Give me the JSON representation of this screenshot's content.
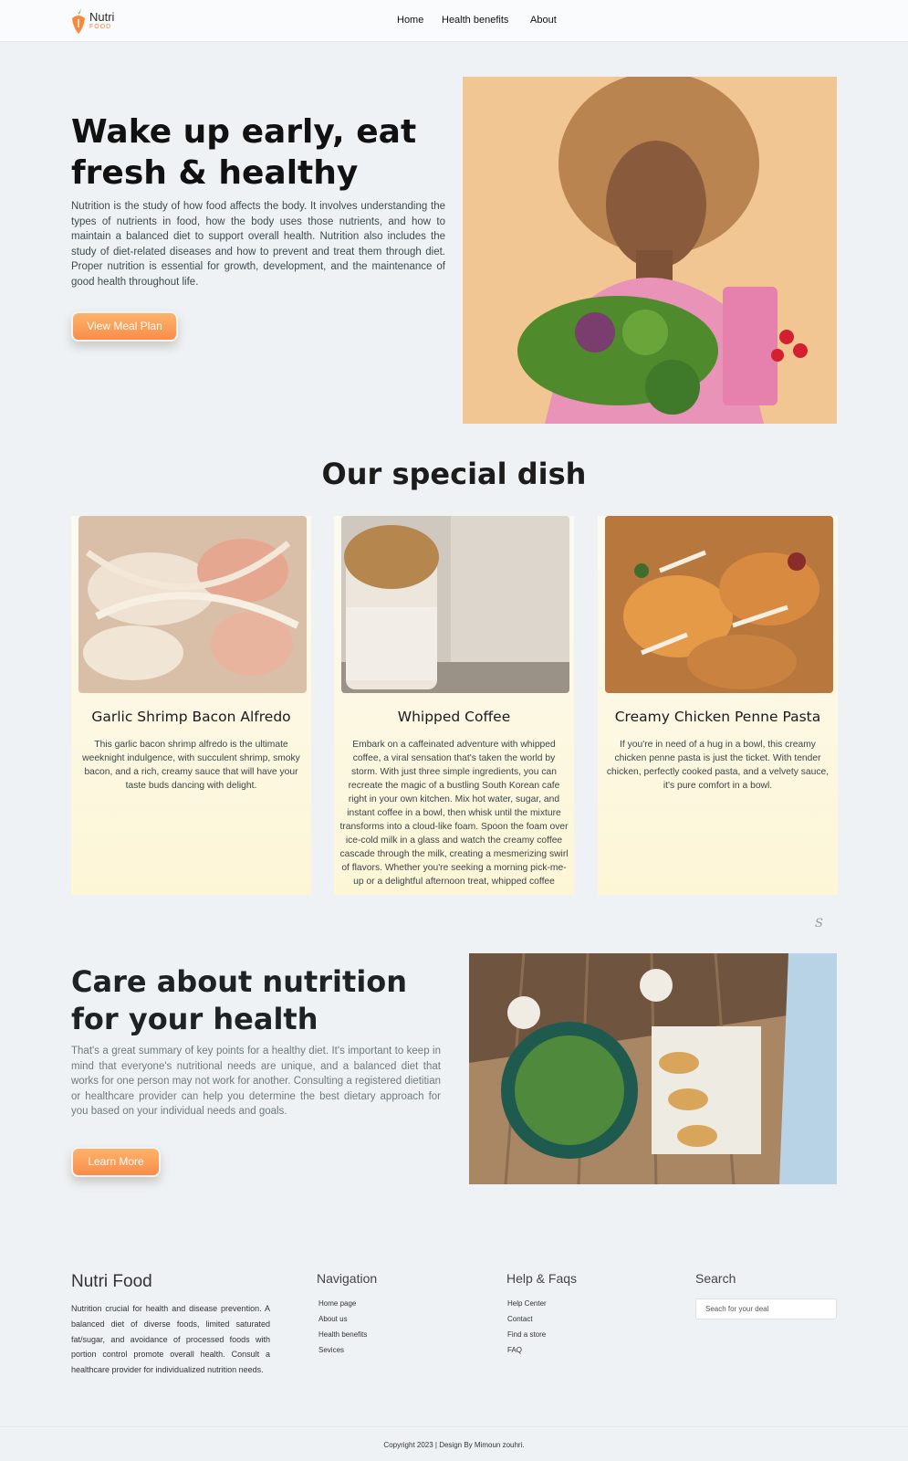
{
  "nav": {
    "logo_top": "Nutri",
    "logo_bottom": "FOOD",
    "links": [
      "Home",
      "Health benefits",
      "About"
    ]
  },
  "hero": {
    "title": "Wake up early, eat fresh & healthy",
    "text": "Nutrition is the study of how food affects the body. It involves understanding the types of nutrients in food, how the body uses those nutrients, and how to maintain a balanced diet to support overall health. Nutrition also includes the study of diet-related diseases and how to prevent and treat them through diet. Proper nutrition is essential for growth, development, and the maintenance of good health throughout life.",
    "button": "View Meal Plan"
  },
  "special": {
    "title": "Our special dish",
    "cards": [
      {
        "title": "Garlic Shrimp Bacon Alfredo",
        "desc": "This garlic bacon shrimp alfredo is the ultimate weeknight indulgence, with succulent shrimp, smoky bacon, and a rich, creamy sauce that will have your taste buds dancing with delight."
      },
      {
        "title": "Whipped Coffee",
        "desc": "Embark on a caffeinated adventure with whipped coffee, a viral sensation that's taken the world by storm. With just three simple ingredients, you can recreate the magic of a bustling South Korean cafe right in your own kitchen. Mix hot water, sugar, and instant coffee in a bowl, then whisk until the mixture transforms into a cloud-like foam. Spoon the foam over ice-cold milk in a glass and watch the creamy coffee cascade through the milk, creating a mesmerizing swirl of flavors. Whether you're seeking a morning pick-me-up or a delightful afternoon treat, whipped coffee"
      },
      {
        "title": "Creamy Chicken Penne Pasta",
        "desc": "If you're in need of a hug in a bowl, this creamy chicken penne pasta is just the ticket. With tender chicken, perfectly cooked pasta, and a velvety sauce, it's pure comfort in a bowl."
      }
    ]
  },
  "care": {
    "title": "Care about nutrition for your health",
    "text": "That's a great summary of key points for a healthy diet. It's important to keep in mind that everyone's nutritional needs are unique, and a balanced diet that works for one person may not work for another. Consulting a registered dietitian or healthcare provider can help you determine the best dietary approach for you based on your individual needs and goals.",
    "button": "Learn More"
  },
  "footer": {
    "brand": "Nutri Food",
    "brand_text": "Nutrition crucial for health and disease prevention. A balanced diet of diverse foods, limited saturated fat/sugar, and avoidance of processed foods with portion control promote overall health. Consult a healthcare provider for individualized nutrition needs.",
    "nav_title": "Navigation",
    "nav_links": [
      "Home page",
      "About us",
      "Health benefits",
      "Sevices"
    ],
    "help_title": "Help & Faqs",
    "help_links": [
      "Help Center",
      "Contact",
      "Find a store",
      "FAQ"
    ],
    "search_title": "Search",
    "search_placeholder": "Seach for your deal",
    "copyright": "Copyright 2023 | Design By Mimoun zouhri."
  },
  "colors": {
    "accent": "#f98d4a",
    "card_bg": "#fdf6d6",
    "page_bg": "#eef2f4"
  },
  "icons": [
    "carrot-logo-icon",
    "scroll-s-icon"
  ]
}
